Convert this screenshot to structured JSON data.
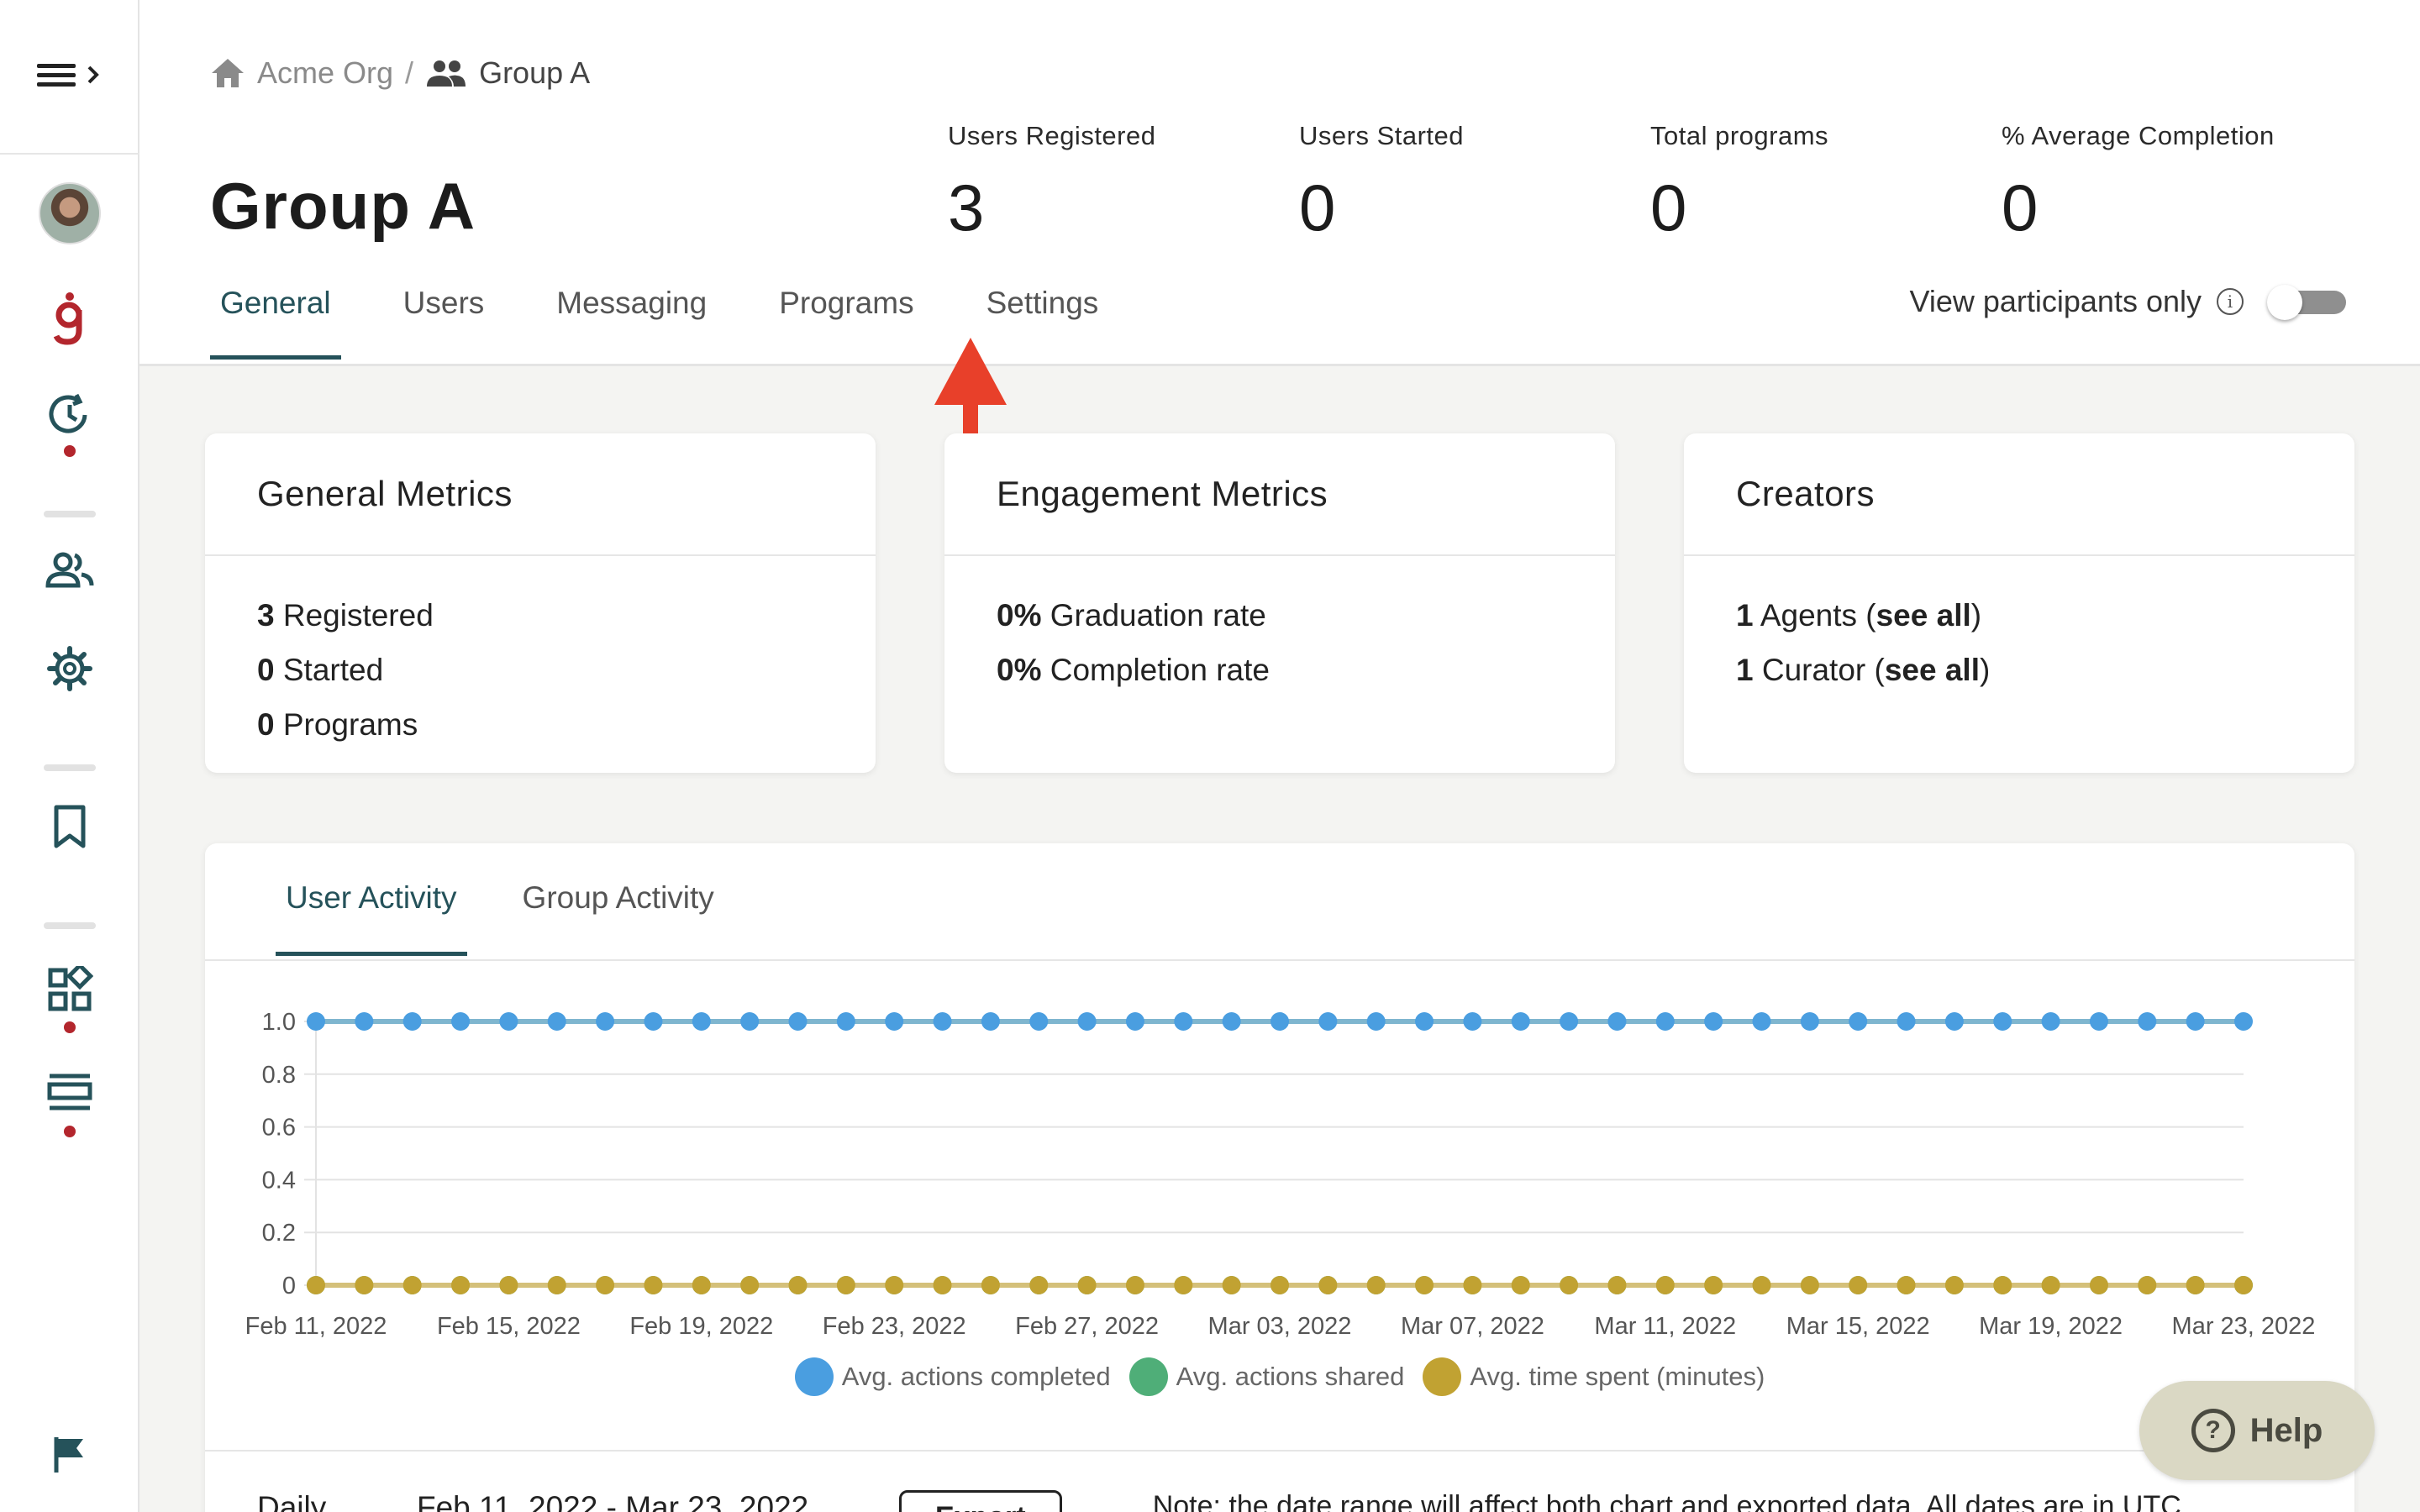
{
  "breadcrumb": {
    "org": "Acme Org",
    "separator": "/",
    "group": "Group A"
  },
  "page_title": "Group A",
  "stats": [
    {
      "label": "Users Registered",
      "value": "3"
    },
    {
      "label": "Users Started",
      "value": "0"
    },
    {
      "label": "Total programs",
      "value": "0"
    },
    {
      "label": "% Average Completion",
      "value": "0"
    }
  ],
  "tabs": [
    "General",
    "Users",
    "Messaging",
    "Programs",
    "Settings"
  ],
  "active_tab": "General",
  "participants_toggle": {
    "label": "View participants only",
    "on": false
  },
  "cards": {
    "general": {
      "title": "General Metrics",
      "lines": [
        {
          "num": "3",
          "text": " Registered"
        },
        {
          "num": "0",
          "text": " Started"
        },
        {
          "num": "0",
          "text": " Programs"
        }
      ]
    },
    "engagement": {
      "title": "Engagement Metrics",
      "lines": [
        {
          "num": "0%",
          "text": " Graduation rate"
        },
        {
          "num": "0%",
          "text": " Completion rate"
        }
      ]
    },
    "creators": {
      "title": "Creators",
      "lines": [
        {
          "num": "1",
          "text": " Agents (",
          "link": "see all",
          "end": ")"
        },
        {
          "num": "1",
          "text": " Curator (",
          "link": "see all",
          "end": ")"
        }
      ]
    }
  },
  "activity_tabs": [
    "User Activity",
    "Group Activity"
  ],
  "active_activity_tab": "User Activity",
  "chart_data": {
    "type": "line",
    "x": [
      "2022-02-11",
      "2022-02-12",
      "2022-02-13",
      "2022-02-14",
      "2022-02-15",
      "2022-02-16",
      "2022-02-17",
      "2022-02-18",
      "2022-02-19",
      "2022-02-20",
      "2022-02-21",
      "2022-02-22",
      "2022-02-23",
      "2022-02-24",
      "2022-02-25",
      "2022-02-26",
      "2022-02-27",
      "2022-02-28",
      "2022-03-01",
      "2022-03-02",
      "2022-03-03",
      "2022-03-04",
      "2022-03-05",
      "2022-03-06",
      "2022-03-07",
      "2022-03-08",
      "2022-03-09",
      "2022-03-10",
      "2022-03-11",
      "2022-03-12",
      "2022-03-13",
      "2022-03-14",
      "2022-03-15",
      "2022-03-16",
      "2022-03-17",
      "2022-03-18",
      "2022-03-19",
      "2022-03-20",
      "2022-03-21",
      "2022-03-22",
      "2022-03-23"
    ],
    "x_tick_labels": [
      "Feb 11, 2022",
      "Feb 15, 2022",
      "Feb 19, 2022",
      "Feb 23, 2022",
      "Feb 27, 2022",
      "Mar 03, 2022",
      "Mar 07, 2022",
      "Mar 11, 2022",
      "Mar 15, 2022",
      "Mar 19, 2022",
      "Mar 23, 2022"
    ],
    "y_ticks": [
      "0",
      "0.2",
      "0.4",
      "0.6",
      "0.8",
      "1.0"
    ],
    "ylim": [
      0,
      1
    ],
    "grid": true,
    "legend": "bottom-center",
    "series": [
      {
        "name": "Avg. actions completed",
        "color": "#4a9ee0",
        "line_color": "#7fb6cf",
        "values": [
          1,
          1,
          1,
          1,
          1,
          1,
          1,
          1,
          1,
          1,
          1,
          1,
          1,
          1,
          1,
          1,
          1,
          1,
          1,
          1,
          1,
          1,
          1,
          1,
          1,
          1,
          1,
          1,
          1,
          1,
          1,
          1,
          1,
          1,
          1,
          1,
          1,
          1,
          1,
          1,
          1
        ]
      },
      {
        "name": "Avg. actions shared",
        "color": "#4fae78",
        "line_color": "#6fbf8f",
        "values": [
          0,
          0,
          0,
          0,
          0,
          0,
          0,
          0,
          0,
          0,
          0,
          0,
          0,
          0,
          0,
          0,
          0,
          0,
          0,
          0,
          0,
          0,
          0,
          0,
          0,
          0,
          0,
          0,
          0,
          0,
          0,
          0,
          0,
          0,
          0,
          0,
          0,
          0,
          0,
          0,
          0
        ]
      },
      {
        "name": "Avg. time spent (minutes)",
        "color": "#c1a232",
        "line_color": "#d4c07a",
        "values": [
          0,
          0,
          0,
          0,
          0,
          0,
          0,
          0,
          0,
          0,
          0,
          0,
          0,
          0,
          0,
          0,
          0,
          0,
          0,
          0,
          0,
          0,
          0,
          0,
          0,
          0,
          0,
          0,
          0,
          0,
          0,
          0,
          0,
          0,
          0,
          0,
          0,
          0,
          0,
          0,
          0
        ]
      }
    ]
  },
  "bottom": {
    "interval": "Daily",
    "range": "Feb 11, 2022 - Mar 23, 2022",
    "export_label": "Export",
    "note": "Note: the date range will affect both chart and exported data. All dates are in UTC."
  },
  "help_label": "Help",
  "colors": {
    "accent": "#25525a",
    "brand_red": "#b3262d",
    "arrow": "#e8402a"
  }
}
